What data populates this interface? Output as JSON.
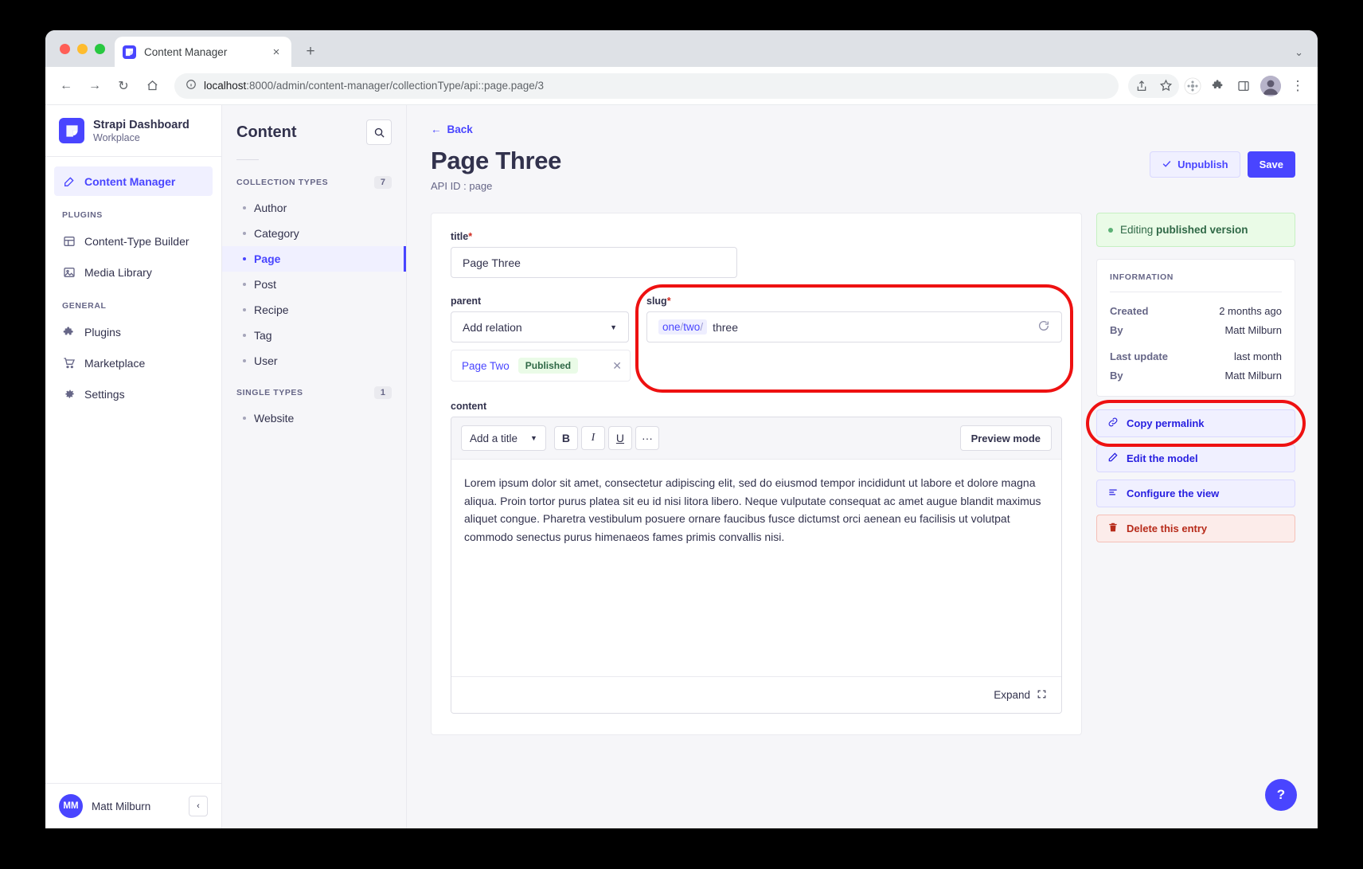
{
  "browser": {
    "tab": {
      "title": "Content Manager",
      "favicon": "strapi-logo-icon",
      "close": "×"
    },
    "new_tab_label": "+",
    "window_caret": "⌄",
    "url_scheme_icon": "info-circle-icon",
    "url_host": "localhost",
    "url_path": ":8000/admin/content-manager/collectionType/api::page.page/3",
    "nav": {
      "back": "←",
      "forward": "→",
      "reload": "↻",
      "home": "⌂"
    },
    "actions": {
      "share": "share-icon",
      "bookmark": "star-icon",
      "extensions": "puzzle-icon",
      "menu": "⋮"
    }
  },
  "sidebar": {
    "brand": {
      "name": "Strapi Dashboard",
      "sub": "Workplace"
    },
    "primary": [
      {
        "label": "Content Manager",
        "icon": "pencil-square-icon",
        "active": true
      }
    ],
    "groups": [
      {
        "label": "PLUGINS",
        "items": [
          {
            "label": "Content-Type Builder",
            "icon": "layout-icon"
          },
          {
            "label": "Media Library",
            "icon": "image-icon"
          }
        ]
      },
      {
        "label": "GENERAL",
        "items": [
          {
            "label": "Plugins",
            "icon": "puzzle-icon"
          },
          {
            "label": "Marketplace",
            "icon": "shopping-cart-icon"
          },
          {
            "label": "Settings",
            "icon": "gear-icon"
          }
        ]
      }
    ],
    "user": {
      "initials": "MM",
      "name": "Matt Milburn",
      "collapse": "‹"
    }
  },
  "content_panel": {
    "title": "Content",
    "search_icon": "search-icon",
    "sections": [
      {
        "label": "COLLECTION TYPES",
        "count": "7",
        "items": [
          "Author",
          "Category",
          "Page",
          "Post",
          "Recipe",
          "Tag",
          "User"
        ],
        "active": "Page"
      },
      {
        "label": "SINGLE TYPES",
        "count": "1",
        "items": [
          "Website"
        ],
        "active": ""
      }
    ]
  },
  "main": {
    "back_label": "Back",
    "title": "Page Three",
    "api_id": "API ID : page",
    "unpublish_label": "Unpublish",
    "save_label": "Save",
    "fields": {
      "title": {
        "label": "title",
        "required": "*",
        "value": "Page Three"
      },
      "parent": {
        "label": "parent",
        "placeholder": "Add relation",
        "relation": {
          "name": "Page Two",
          "status": "Published",
          "remove": "✕"
        }
      },
      "slug": {
        "label": "slug",
        "required": "*",
        "prefix_one": "one",
        "prefix_two": "two",
        "value": "three",
        "refresh_icon": "refresh-icon"
      },
      "content": {
        "label": "content",
        "toolbar": {
          "title_select": "Add a title",
          "bold": "B",
          "italic": "I",
          "underline": "U",
          "more": "···",
          "preview": "Preview mode"
        },
        "body": "Lorem ipsum dolor sit amet, consectetur adipiscing elit, sed do eiusmod tempor incididunt ut labore et dolore magna aliqua. Proin tortor purus platea sit eu id nisi litora libero. Neque vulputate consequat ac amet augue blandit maximus aliquet congue. Pharetra vestibulum posuere ornare faucibus fusce dictumst orci aenean eu facilisis ut volutpat commodo senectus purus himenaeos fames primis convallis nisi.",
        "expand_label": "Expand"
      }
    }
  },
  "info_panel": {
    "version_banner_prefix": "Editing ",
    "version_banner_bold": "published version",
    "section_title": "INFORMATION",
    "rows": [
      {
        "key": "Created",
        "value": "2 months ago"
      },
      {
        "key": "By",
        "value": "Matt Milburn"
      },
      {
        "key": "Last update",
        "value": "last month"
      },
      {
        "key": "By",
        "value": "Matt Milburn"
      }
    ],
    "actions": [
      {
        "label": "Copy permalink",
        "icon": "link-icon",
        "kind": "normal",
        "highlighted": true
      },
      {
        "label": "Edit the model",
        "icon": "pencil-icon",
        "kind": "normal"
      },
      {
        "label": "Configure the view",
        "icon": "sliders-icon",
        "kind": "normal"
      },
      {
        "label": "Delete this entry",
        "icon": "trash-icon",
        "kind": "danger"
      }
    ]
  },
  "help": {
    "label": "?"
  },
  "colors": {
    "accent": "#4945ff",
    "highlight_ring": "#ee1111",
    "success": "#2f6846",
    "danger": "#b72b1a"
  }
}
